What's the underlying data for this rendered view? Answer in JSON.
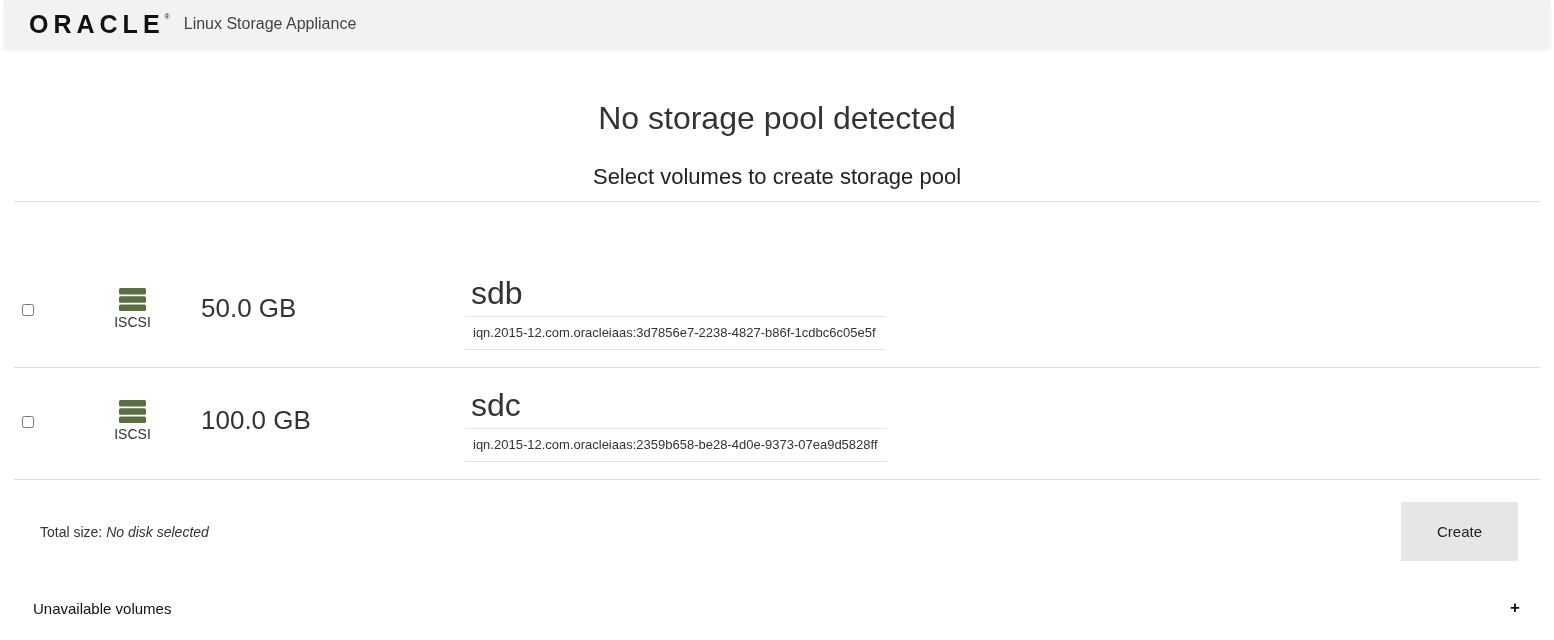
{
  "header": {
    "logo": "ORACLE",
    "logo_mark": "®",
    "product": "Linux Storage Appliance"
  },
  "heading": "No storage pool detected",
  "subheading": "Select volumes to create storage pool",
  "volumes": [
    {
      "checked": false,
      "type": "ISCSI",
      "size": "50.0 GB",
      "name": "sdb",
      "iqn": "iqn.2015-12.com.oracleiaas:3d7856e7-2238-4827-b86f-1cdbc6c05e5f"
    },
    {
      "checked": false,
      "type": "ISCSI",
      "size": "100.0 GB",
      "name": "sdc",
      "iqn": "iqn.2015-12.com.oracleiaas:2359b658-be28-4d0e-9373-07ea9d5828ff"
    }
  ],
  "total": "Total size: *No disk selected*",
  "create_button": "Create",
  "unavailable": {
    "label": "Unavailable volumes",
    "toggle": "+"
  }
}
